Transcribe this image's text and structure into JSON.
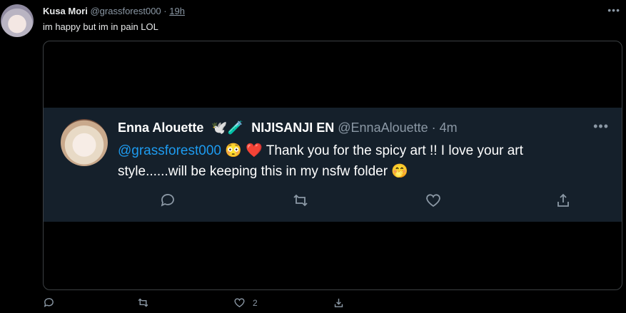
{
  "tweet": {
    "display_name": "Kusa Mori",
    "handle": "@grassforest000",
    "separator": "·",
    "time": "19h",
    "text": "im happy but im in pain LOL",
    "more_icon": "more-horizontal-icon"
  },
  "embedded": {
    "display_name": "Enna Alouette",
    "badge_emojis": "🕊️🧪",
    "org": "NIJISANJI EN",
    "handle": "@EnnaAlouette",
    "separator": "·",
    "time": "4m",
    "mention": "@grassforest000",
    "emoji_1": "😳",
    "emoji_2": "❤️",
    "text": " Thank you for the spicy art !! I love your art style......will be keeping this in my nsfw folder ",
    "emoji_3": "🤭",
    "background": "#15202b"
  },
  "actions": {
    "like_count": "2"
  },
  "colors": {
    "accent": "#1d9bf0",
    "muted": "#8b98a5",
    "background": "#000000"
  }
}
